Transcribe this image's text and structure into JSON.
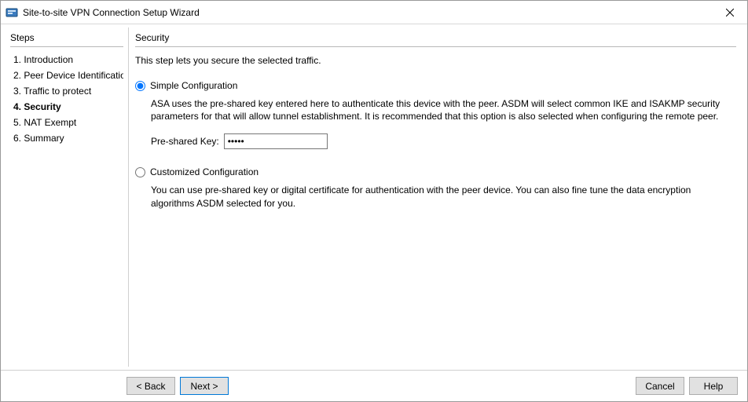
{
  "window": {
    "title": "Site-to-site VPN Connection Setup Wizard"
  },
  "sidebar": {
    "header": "Steps",
    "items": [
      {
        "label": "1. Introduction"
      },
      {
        "label": "2. Peer Device Identificatio"
      },
      {
        "label": "3. Traffic to protect"
      },
      {
        "label": "4. Security"
      },
      {
        "label": "5. NAT Exempt"
      },
      {
        "label": "6. Summary"
      }
    ],
    "activeIndex": 3
  },
  "content": {
    "header": "Security",
    "intro": "This step lets you secure the selected traffic.",
    "simple": {
      "label": "Simple Configuration",
      "desc": "ASA uses the pre-shared key entered here to authenticate this device with the peer. ASDM will select common IKE and ISAKMP security parameters for that will allow tunnel establishment. It is recommended that this option is also selected when configuring the remote peer.",
      "psk_label": "Pre-shared Key:",
      "psk_value": "•••••"
    },
    "custom": {
      "label": "Customized Configuration",
      "desc": "You can use pre-shared key or digital certificate for authentication with the peer device. You can also fine tune the data encryption algorithms ASDM selected for you."
    },
    "selected": "simple"
  },
  "footer": {
    "back": "< Back",
    "next": "Next >",
    "cancel": "Cancel",
    "help": "Help"
  }
}
